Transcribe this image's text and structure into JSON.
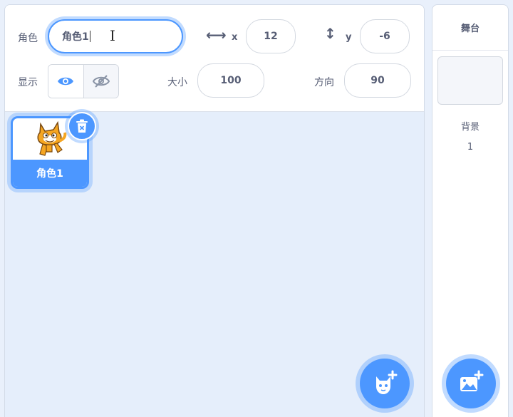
{
  "sprite_info": {
    "name_label": "角色",
    "name_value": "角色1",
    "x_label": "x",
    "x_value": "12",
    "y_label": "y",
    "y_value": "-6",
    "show_label": "显示",
    "size_label": "大小",
    "size_value": "100",
    "direction_label": "方向",
    "direction_value": "90"
  },
  "sprites": [
    {
      "name": "角色1",
      "selected": true
    }
  ],
  "stage": {
    "title": "舞台",
    "backdrop_label": "背景",
    "backdrop_count": "1"
  },
  "colors": {
    "accent": "#4c97ff",
    "text": "#575e75"
  },
  "icons": {
    "show": "eye-icon",
    "hide": "eye-slash-icon",
    "x_arrow": "horizontal-arrows-icon",
    "y_arrow": "vertical-arrows-icon",
    "delete": "trash-icon",
    "add_sprite": "cat-plus-icon",
    "add_backdrop": "image-plus-icon"
  }
}
